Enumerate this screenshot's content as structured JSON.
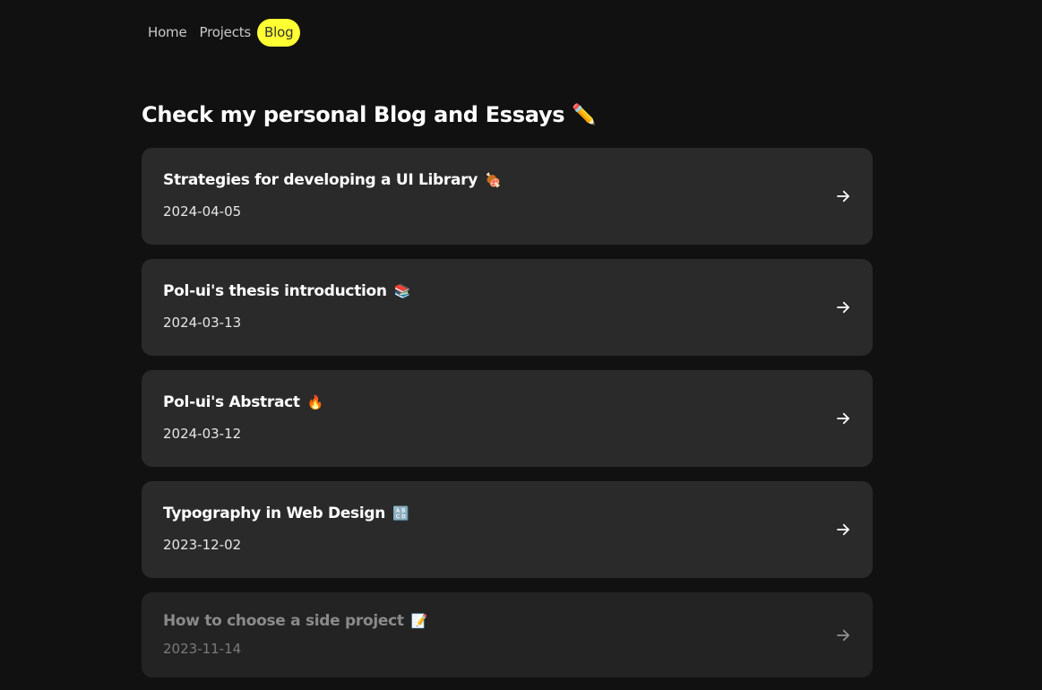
{
  "nav": {
    "items": [
      {
        "label": "Home",
        "active": false
      },
      {
        "label": "Projects",
        "active": false
      },
      {
        "label": "Blog",
        "active": true
      }
    ]
  },
  "heading": {
    "text": "Check my personal Blog and Essays",
    "emoji": "✏️"
  },
  "posts": [
    {
      "title": "Strategies for developing a UI Library",
      "emoji": "🍖",
      "date": "2024-04-05"
    },
    {
      "title": "Pol-ui's thesis introduction",
      "emoji": "📚",
      "date": "2024-03-13"
    },
    {
      "title": "Pol-ui's Abstract",
      "emoji": "🔥",
      "date": "2024-03-12"
    },
    {
      "title": "Typography in Web Design",
      "emoji": "🔠",
      "date": "2023-12-02"
    },
    {
      "title": "How to choose a side project",
      "emoji": "📝",
      "date": "2023-11-14"
    }
  ],
  "colors": {
    "background": "#111111",
    "card": "#2a2a2a",
    "accent": "#ffff33"
  },
  "icons": {
    "arrow": "arrow-right-icon"
  }
}
